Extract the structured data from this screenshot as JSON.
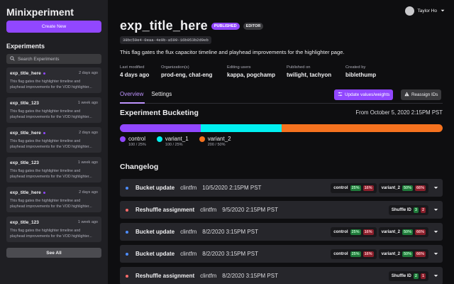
{
  "app": {
    "title": "Minixperiment",
    "create_label": "Create New"
  },
  "sidebar": {
    "section_title": "Experiments",
    "search_placeholder": "Search Experiments",
    "see_all_label": "See All",
    "items": [
      {
        "name": "exp_title_here",
        "time": "2 days ago",
        "desc": [
          "This flag gates the highlighter timeline and",
          "playhead improvements for the VOD highlighter..."
        ]
      },
      {
        "name": "exp_title_123",
        "time": "1 week ago",
        "desc": [
          "This flag gates the highlighter timeline and",
          "playhead improvements for the VOD highlighter..."
        ]
      },
      {
        "name": "exp_title_here",
        "time": "2 days ago",
        "desc": [
          "This flag gates the highlighter timeline and",
          "playhead improvements for the VOD highlighter..."
        ]
      },
      {
        "name": "exp_title_123",
        "time": "1 week ago",
        "desc": [
          "This flag gates the highlighter timeline and",
          "playhead improvements for the VOD highlighter..."
        ]
      },
      {
        "name": "exp_title_here",
        "time": "2 days ago",
        "desc": [
          "This flag gates the highlighter timeline and",
          "playhead improvements for the VOD highlighter..."
        ]
      },
      {
        "name": "exp_title_123",
        "time": "1 week ago",
        "desc": [
          "This flag gates the highlighter timeline and",
          "playhead improvements for the VOD highlighter..."
        ]
      }
    ]
  },
  "user": {
    "name": "Taylor Ho"
  },
  "experiment": {
    "title": "exp_title_here",
    "badge_published": "PUBLISHED",
    "badge_editor": "EDITOR",
    "flag_id": "38bc59e4-0eaa-4e9b-a599-16b053b2d9eb",
    "description": "This flag gates the flux capacitor timeline and playhead improvements for the highlighter page.",
    "meta": [
      {
        "label": "Last modified",
        "value": "4 days ago"
      },
      {
        "label": "Organization(s)",
        "value": "prod-eng, chat-eng"
      },
      {
        "label": "Editing users",
        "value": "kappa, pogchamp"
      },
      {
        "label": "Published on",
        "value": "twilight, tachyon"
      },
      {
        "label": "Created by",
        "value": "biblethump"
      }
    ]
  },
  "tabs": {
    "overview": "Overview",
    "settings": "Settings"
  },
  "actions": {
    "update_label": "Update values/weights",
    "reassign_label": "Reassign IDs"
  },
  "bucketing": {
    "title": "Experiment Bucketing",
    "date": "From October 5, 2020 2:15PM PST",
    "groups": [
      {
        "name": "control",
        "detail": "100 / 25%",
        "fraction": 0.25,
        "color": "#9147ff"
      },
      {
        "name": "variant_1",
        "detail": "100 / 25%",
        "fraction": 0.25,
        "color": "#00f0f0"
      },
      {
        "name": "variant_2",
        "detail": "200 / 50%",
        "fraction": 0.5,
        "color": "#f5721f"
      }
    ]
  },
  "changelog": {
    "title": "Changelog",
    "entries": [
      {
        "title": "Bucket update",
        "user": "clintfm",
        "time": "10/5/2020 2:15PM PST",
        "dot_color": "#4d8dff",
        "kind": "bucket",
        "control_label": "control",
        "control_a": "25%",
        "control_b": "16%",
        "variant_label": "variant_2",
        "variant_a": "50%",
        "variant_b": "66%"
      },
      {
        "title": "Reshuffle assignment",
        "user": "clintfm",
        "time": "9/5/2020 2:15PM PST",
        "dot_color": "#ff6b6b",
        "kind": "shuffle",
        "shuffle_label": "Shuffle ID",
        "shuffle_a": "3",
        "shuffle_b": "2"
      },
      {
        "title": "Bucket update",
        "user": "clintfm",
        "time": "8/2/2020 3:15PM PST",
        "dot_color": "#4d8dff",
        "kind": "bucket",
        "control_label": "control",
        "control_a": "25%",
        "control_b": "16%",
        "variant_label": "variant_2",
        "variant_a": "50%",
        "variant_b": "66%"
      },
      {
        "title": "Bucket update",
        "user": "clintfm",
        "time": "8/2/2020 3:15PM PST",
        "dot_color": "#4d8dff",
        "kind": "bucket",
        "control_label": "control",
        "control_a": "25%",
        "control_b": "16%",
        "variant_label": "variant_2",
        "variant_a": "50%",
        "variant_b": "66%"
      },
      {
        "title": "Reshuffle assignment",
        "user": "clintfm",
        "time": "8/2/2020 3:15PM PST",
        "dot_color": "#ff6b6b",
        "kind": "shuffle",
        "shuffle_label": "Shuffle ID",
        "shuffle_a": "2",
        "shuffle_b": "1"
      }
    ]
  }
}
